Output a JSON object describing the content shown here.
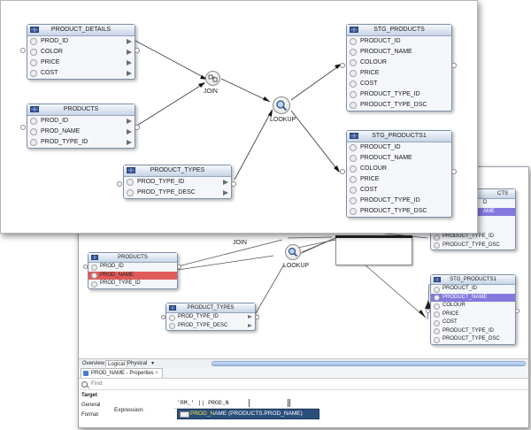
{
  "front": {
    "tables": {
      "product_details": {
        "title": "PRODUCT_DETAILS",
        "rows": [
          "PROD_ID",
          "COLOR",
          "PRICE",
          "COST"
        ]
      },
      "products": {
        "title": "PRODUCTS",
        "rows": [
          "PROD_ID",
          "PROD_NAME",
          "PROD_TYPE_ID"
        ]
      },
      "product_types": {
        "title": "PRODUCT_TYPES",
        "rows": [
          "PROD_TYPE_ID",
          "PROD_TYPE_DESC"
        ]
      },
      "stg_products": {
        "title": "STG_PRODUCTS",
        "rows": [
          "PRODUCT_ID",
          "PRODUCT_NAME",
          "COLOUR",
          "PRICE",
          "COST",
          "PRODUCT_TYPE_ID",
          "PRODUCT_TYPE_DSC"
        ]
      },
      "stg_products1": {
        "title": "STG_PRODUCTS1",
        "rows": [
          "PRODUCT_ID",
          "PRODUCT_NAME",
          "COLOUR",
          "PRICE",
          "COST",
          "PRODUCT_TYPE_ID",
          "PRODUCT_TYPE_DSC"
        ]
      }
    },
    "nodes": {
      "join": "JOIN",
      "lookup": "LOOKUP"
    }
  },
  "back": {
    "join_label": "JOIN",
    "lookup_label": "LOOKUP",
    "products": {
      "title": "PRODUCTS",
      "rows": [
        "PROD_ID",
        "PROD_NAME",
        "PROD_TYPE_ID"
      ],
      "error_row": "PROD_NAME"
    },
    "product_types": {
      "title": "PRODUCT_TYPES",
      "rows": [
        "PROD_TYPE_ID",
        "PROD_TYPE_DESC"
      ]
    },
    "stg_products_partial": {
      "title_fragment": "CTS",
      "row1_fragment": "D",
      "row2_fragment": "AME",
      "rows": [
        "PRODUCT_TYPE_ID",
        "PRODUCT_TYPE_DSC"
      ]
    },
    "stg_products1": {
      "title": "STG_PRODUCTS1",
      "rows": [
        "PRODUCT_ID",
        "PRODUCT_NAME",
        "COLOUR",
        "PRICE",
        "COST",
        "PRODUCT_TYPE_ID",
        "PRODUCT_TYPE_DSC"
      ],
      "selected_row": "PRODUCT_NAME"
    },
    "tabs": [
      "Overview",
      "Logical",
      "Physical"
    ],
    "tab_dropdown": "▾",
    "active_tab": "Logical",
    "properties": {
      "tab_title": "PROD_NAME - Properties",
      "close_glyph": "×",
      "find_placeholder": "Find",
      "side": {
        "header": "Target",
        "items": [
          "General",
          "Format"
        ]
      },
      "expression_label": "Expression:",
      "expression_value": "'RM_' || PROD_N",
      "suggestion": {
        "match": "PROD_N",
        "rest": "AME (PRODUCTS.PROD_NAME)"
      }
    }
  },
  "colors": {
    "selection": "#8478e0",
    "error": "#e05a5a",
    "suggest_bg": "#2a4e7c",
    "highlight": "#f5e84a"
  }
}
